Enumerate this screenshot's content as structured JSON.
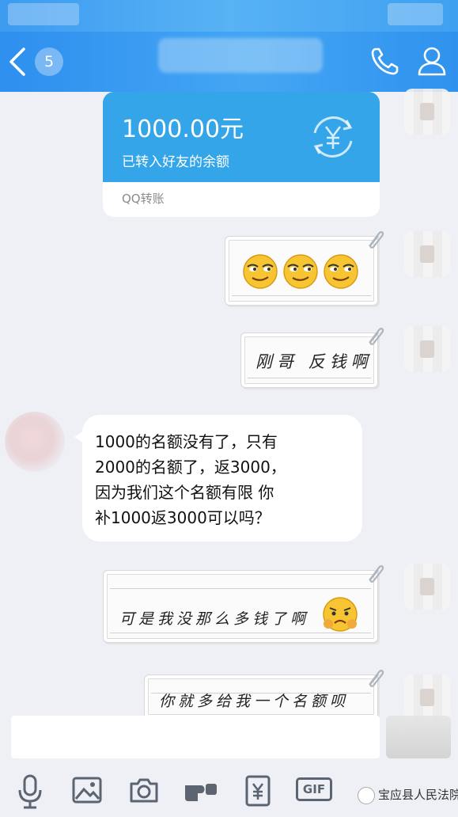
{
  "header": {
    "unread_count": "5",
    "icons": [
      "back-arrow-icon",
      "phone-icon",
      "profile-icon"
    ]
  },
  "messages": {
    "transfer": {
      "amount": "1000.00元",
      "description": "已转入好友的余额",
      "footer": "QQ转账",
      "icon": "yuan-transfer-icon"
    },
    "emoji_reply": {
      "emoji": [
        "smirk-emoji",
        "smirk-emoji",
        "smirk-emoji"
      ]
    },
    "sent_1": "刚哥 反钱啊",
    "received_1": {
      "lines": [
        "1000的名额没有了，只有",
        "2000的名额了，返3000，",
        "因为我们这个名额有限  你",
        "补1000返3000可以吗？"
      ]
    },
    "sent_2": "可是我没那么多钱了啊",
    "sent_2_emoji": "worried-emoji",
    "sent_3": "你就多给我一个名额呗"
  },
  "toolbar": {
    "icons": [
      "microphone-icon",
      "image-icon",
      "camera-icon",
      "red-packet-icon",
      "transfer-icon",
      "gif-icon",
      "emoji-icon"
    ],
    "gif_label": "GIF"
  },
  "watermark": "宝应县人民法院",
  "colors": {
    "header_blue": "#2e8fef",
    "transfer_blue": "#34a5e8",
    "background": "#eef0f6"
  }
}
